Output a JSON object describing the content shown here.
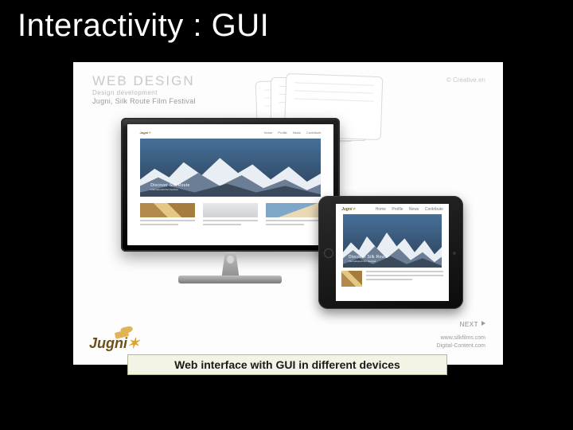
{
  "slide": {
    "title": "Interactivity : GUI",
    "caption": "Web interface with GUI in different devices"
  },
  "mockup": {
    "heading": "WEB DESIGN",
    "subheading_small": "Design development",
    "subheading": "Jugni, Silk Route Film Festival",
    "attribution": "© Creative.en",
    "next_label": "NEXT",
    "footer_line1": "www.silkfilms.com",
    "footer_line2": "Digital-Content.com"
  },
  "site": {
    "logo_main": "Jugni",
    "logo_accent": "✶",
    "nav": [
      "Home",
      "Profile",
      "News",
      "Contribute"
    ],
    "hero_title": "Discover Silk Route",
    "hero_sub": "International Film Festival"
  }
}
